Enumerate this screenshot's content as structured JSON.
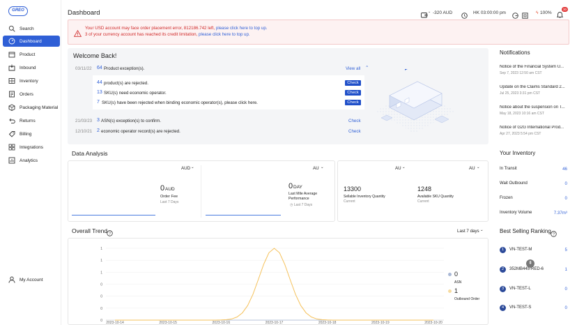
{
  "app": {
    "logo": "GREO"
  },
  "sidebar": {
    "items": [
      {
        "label": "Search",
        "icon": "search-icon"
      },
      {
        "label": "Dashboard",
        "icon": "dashboard-icon",
        "active": true
      },
      {
        "label": "Product",
        "icon": "product-icon"
      },
      {
        "label": "Inbound",
        "icon": "inbound-icon"
      },
      {
        "label": "Inventory",
        "icon": "inventory-icon"
      },
      {
        "label": "Orders",
        "icon": "orders-icon"
      },
      {
        "label": "Packaging Material",
        "icon": "packaging-icon"
      },
      {
        "label": "Returns",
        "icon": "returns-icon"
      },
      {
        "label": "Billing",
        "icon": "billing-icon"
      },
      {
        "label": "Integrations",
        "icon": "integrations-icon"
      },
      {
        "label": "Analytics",
        "icon": "analytics-icon"
      }
    ],
    "account": "My Account"
  },
  "header": {
    "title": "Dashboard",
    "balance": "-320 AUD",
    "timezone": "HK 03:00:00 pm",
    "zoom": "100%",
    "notif_count": "30"
  },
  "alert": {
    "line1_a": "Your USD account may face order placement error, 812186.742 left, ",
    "line1_link": "please click here to top up.",
    "line2_a": "3 of your currency account has reached its credit limitation, ",
    "line2_link": "please click here to top up."
  },
  "welcome": {
    "title": "Welcome Back!",
    "view_all": "View all",
    "rows": [
      {
        "date": "03/11/22",
        "count": "64",
        "text": "Product exception(s)."
      },
      {
        "count": "44",
        "text": "product(s) are rejected.",
        "action": "Check"
      },
      {
        "count": "13",
        "text": "SKU(s) need economic operator.",
        "action": "Check"
      },
      {
        "count": "7",
        "text": "SKU(s) have been rejected when binding economic operator(s), please click here.",
        "action": "Check"
      },
      {
        "date": "21/03/23",
        "count": "3",
        "text": "ASN(s) exception(s) to confirm.",
        "action": "Check"
      },
      {
        "date": "12/10/21",
        "count": "2",
        "text": "economic operator record(s) are rejected.",
        "action": "Check"
      }
    ]
  },
  "data_analysis": {
    "title": "Data Analysis",
    "cards": [
      {
        "currency": "AUD",
        "value": "0",
        "unit": "AUD",
        "label": "Order Fee",
        "sub": "Last 7 Days"
      },
      {
        "currency": "AU",
        "value": "0",
        "unit": "DAY",
        "label": "Last Mile Average Performance",
        "sub": "Last 7 Days"
      },
      {
        "currency": "AU",
        "value": "13300",
        "label": "Sellable Inventory Quantity",
        "sub": "Current"
      },
      {
        "currency": "AU",
        "value": "1248",
        "label": "Available SKU Quantity",
        "sub": "Current"
      }
    ]
  },
  "trend": {
    "title": "Overall Trend",
    "range": "Last 7 days",
    "legend": [
      {
        "value": "0",
        "label": "ASN",
        "color": "#a9b8d6"
      },
      {
        "value": "1",
        "label": "Outbound Order",
        "color": "#f7dca0"
      }
    ]
  },
  "chart_data": {
    "type": "line",
    "x": [
      "2023-10-14",
      "2023-10-15",
      "2023-10-16",
      "2023-10-17",
      "2023-10-18",
      "2023-10-19",
      "2023-10-20"
    ],
    "series": [
      {
        "name": "ASN",
        "values": [
          0,
          0,
          0,
          0,
          0,
          0,
          0
        ],
        "color": "#a9b8d6"
      },
      {
        "name": "Outbound Order",
        "values": [
          0,
          0,
          0,
          1,
          0,
          0,
          0
        ],
        "color": "#f5c15a"
      }
    ],
    "yticks": [
      "0",
      "0",
      "0",
      "0",
      "1",
      "1",
      "1"
    ],
    "ylim": [
      0,
      1
    ]
  },
  "notifications": {
    "title": "Notifications",
    "items": [
      {
        "title": "Notice of the Financial System U...",
        "date": "Sep 7, 2023 12:50 am CST"
      },
      {
        "title": "Update on the Claims Standard 2...",
        "date": "Jul 25, 2023 3:31 pm CST"
      },
      {
        "title": "Notice about the suspension on T...",
        "date": "May 18, 2023 10:16 am CST"
      },
      {
        "title": "Notice of G2G International Prod...",
        "date": "Apr 27, 2023 5:54 pm CST"
      }
    ]
  },
  "inventory": {
    "title": "Your Inventory",
    "rows": [
      {
        "label": "In Transit",
        "value": "46"
      },
      {
        "label": "Wait Outbound",
        "value": "0"
      },
      {
        "label": "Frozen",
        "value": "0"
      },
      {
        "label": "Inventory Volume",
        "value": "7.37m³"
      }
    ]
  },
  "ranking": {
    "title": "Best Selling Ranking",
    "rows": [
      {
        "rank": "1",
        "name": "VN-TEST-M",
        "value": "5"
      },
      {
        "rank": "2",
        "name": "352MB445-RED-6",
        "value": "1"
      },
      {
        "rank": "3",
        "name": "VN-TEST-L",
        "value": "0"
      },
      {
        "rank": "4",
        "name": "VN-TEST-S",
        "value": "0"
      }
    ]
  }
}
